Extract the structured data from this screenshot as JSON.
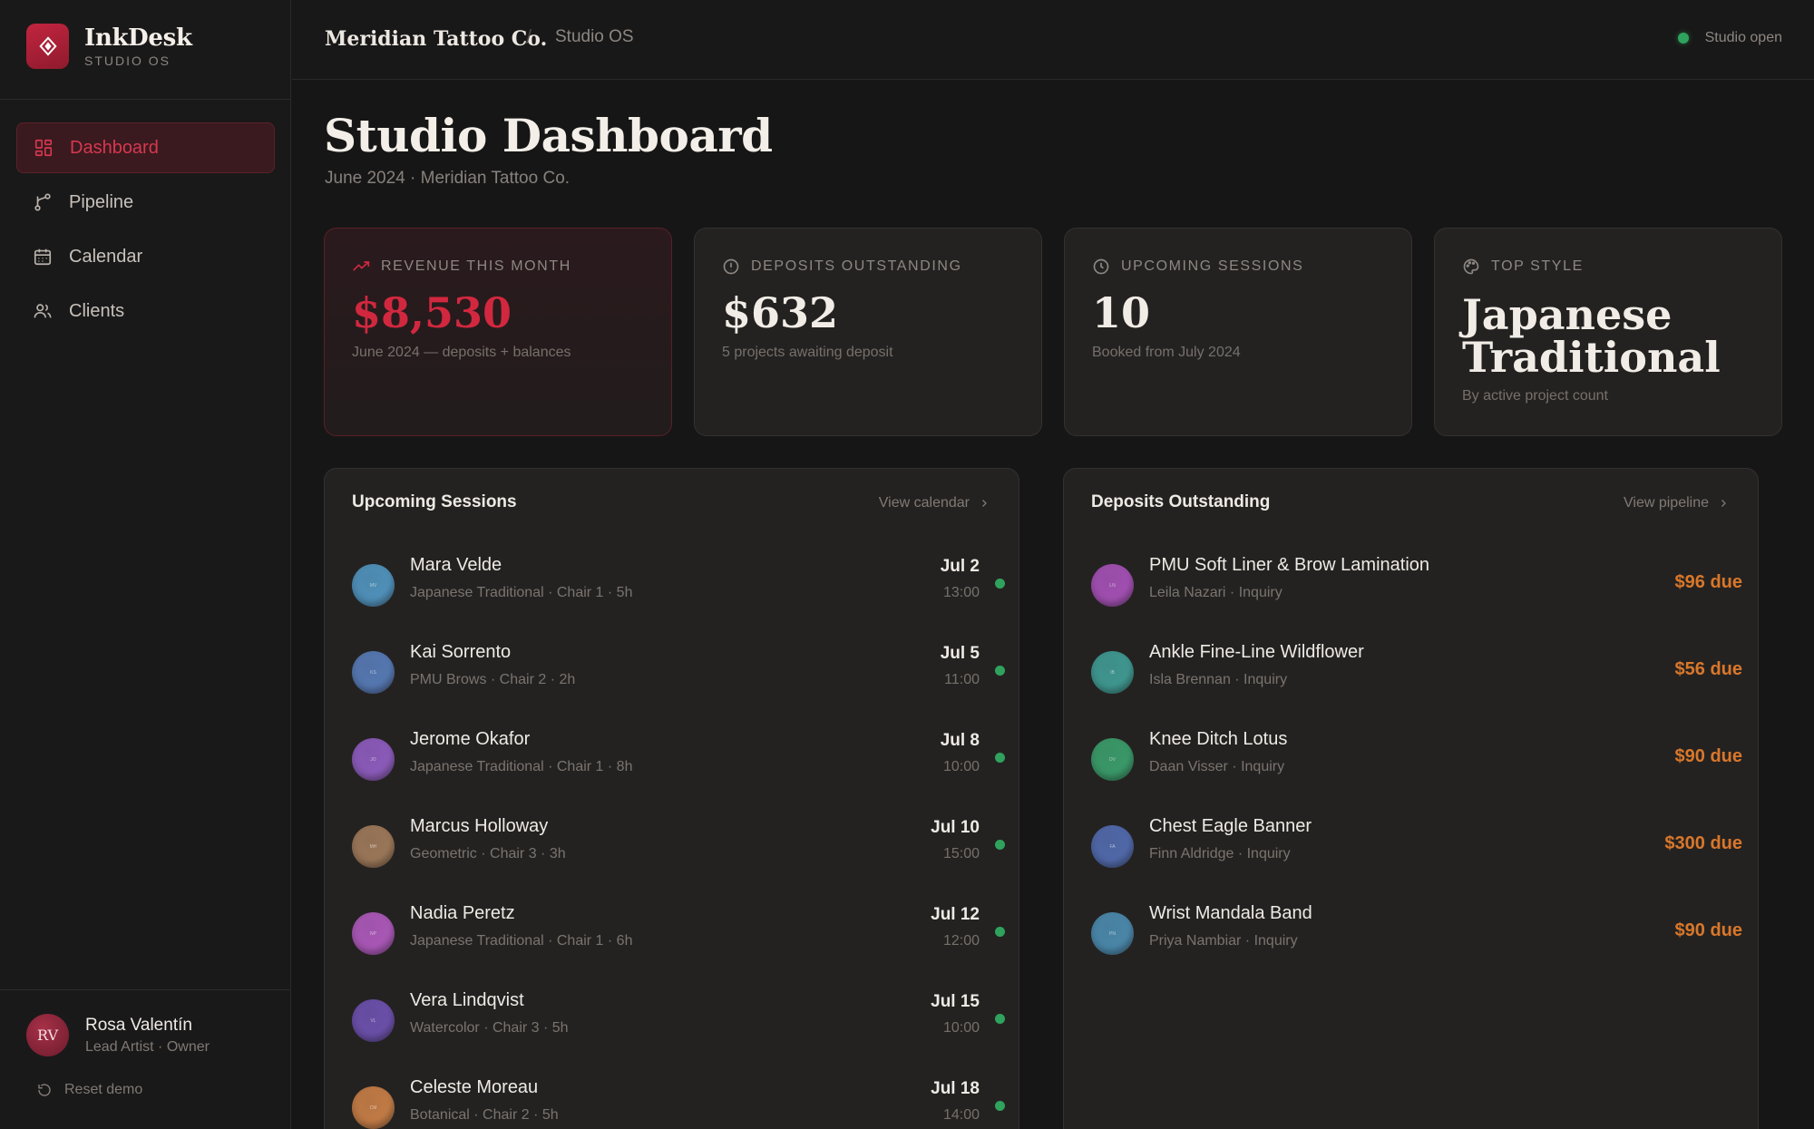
{
  "sidebar": {
    "brand_name": "InkDesk",
    "brand_sub": "STUDIO OS",
    "nav": [
      {
        "label": "Dashboard",
        "icon": "grid-icon",
        "active": true
      },
      {
        "label": "Pipeline",
        "icon": "branch-icon"
      },
      {
        "label": "Calendar",
        "icon": "calendar-icon"
      },
      {
        "label": "Clients",
        "icon": "users-icon"
      }
    ],
    "user": {
      "initials": "RV",
      "name": "Rosa Valentín",
      "role": "Lead Artist · Owner"
    },
    "reset_label": "Reset demo"
  },
  "topbar": {
    "studio": "Meridian Tattoo Co.",
    "separator": "/",
    "app": "Studio OS",
    "status": "Studio open",
    "status_color": "#2fa35e"
  },
  "header": {
    "title": "Studio Dashboard",
    "subtitle": "June 2024 · Meridian Tattoo Co."
  },
  "stats": [
    {
      "label": "REVENUE THIS MONTH",
      "icon": "trending-up-icon",
      "value": "$8,530",
      "note": "June 2024 — deposits + balances"
    },
    {
      "label": "DEPOSITS OUTSTANDING",
      "icon": "alert-circle-icon",
      "value": "$632",
      "note": "5 projects awaiting deposit"
    },
    {
      "label": "UPCOMING SESSIONS",
      "icon": "clock-icon",
      "value": "10",
      "note": "Booked from July 2024"
    },
    {
      "label": "TOP STYLE",
      "icon": "palette-icon",
      "value_line1": "Japanese",
      "value_line2": "Traditional",
      "note": "By active project count"
    }
  ],
  "sessions": {
    "title": "Upcoming Sessions",
    "link": "View calendar",
    "items": [
      {
        "initials": "MV",
        "name": "Mara Velde",
        "detail": "Japanese Traditional · Chair 1 · 5h",
        "date": "Jul 2",
        "time": "13:00",
        "color": "#4f8fb8"
      },
      {
        "initials": "KS",
        "name": "Kai Sorrento",
        "detail": "PMU Brows · Chair 2 · 2h",
        "date": "Jul 5",
        "time": "11:00",
        "color": "#5577b0"
      },
      {
        "initials": "JO",
        "name": "Jerome Okafor",
        "detail": "Japanese Traditional · Chair 1 · 8h",
        "date": "Jul 8",
        "time": "10:00",
        "color": "#8a5ab8"
      },
      {
        "initials": "MH",
        "name": "Marcus Holloway",
        "detail": "Geometric · Chair 3 · 3h",
        "date": "Jul 10",
        "time": "15:00",
        "color": "#9a7658"
      },
      {
        "initials": "NP",
        "name": "Nadia Peretz",
        "detail": "Japanese Traditional · Chair 1 · 6h",
        "date": "Jul 12",
        "time": "12:00",
        "color": "#a857b5"
      },
      {
        "initials": "VL",
        "name": "Vera Lindqvist",
        "detail": "Watercolor · Chair 3 · 5h",
        "date": "Jul 15",
        "time": "10:00",
        "color": "#6a4fa8"
      },
      {
        "initials": "CM",
        "name": "Celeste Moreau",
        "detail": "Botanical · Chair 2 · 5h",
        "date": "Jul 18",
        "time": "14:00",
        "color": "#c07a45"
      }
    ]
  },
  "deposits": {
    "title": "Deposits Outstanding",
    "link": "View pipeline",
    "items": [
      {
        "initials": "LN",
        "project": "PMU Soft Liner & Brow Lamination",
        "detail": "Leila Nazari · Inquiry",
        "due": "$96 due",
        "color": "#a04fb0"
      },
      {
        "initials": "IB",
        "project": "Ankle Fine-Line Wildflower",
        "detail": "Isla Brennan · Inquiry",
        "due": "$56 due",
        "color": "#3f968f"
      },
      {
        "initials": "DV",
        "project": "Knee Ditch Lotus",
        "detail": "Daan Visser · Inquiry",
        "due": "$90 due",
        "color": "#3a9868"
      },
      {
        "initials": "FA",
        "project": "Chest Eagle Banner",
        "detail": "Finn Aldridge · Inquiry",
        "due": "$300 due",
        "color": "#5068a8"
      },
      {
        "initials": "PN",
        "project": "Wrist Mandala Band",
        "detail": "Priya Nambiar · Inquiry",
        "due": "$90 due",
        "color": "#4a86a8"
      }
    ]
  },
  "colors": {
    "accent": "#d1283f",
    "due": "#d9772a",
    "background": "#171616",
    "card": "#242221"
  }
}
